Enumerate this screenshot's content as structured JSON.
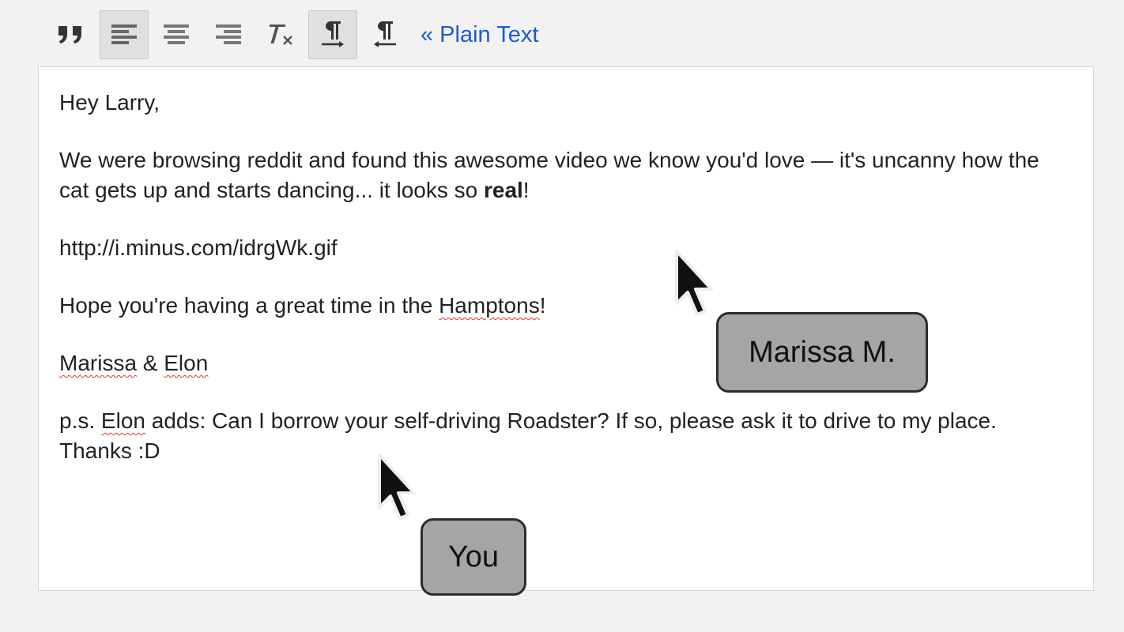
{
  "toolbar": {
    "buttons": [
      {
        "icon": "quote-icon",
        "active": false
      },
      {
        "icon": "align-left-icon",
        "active": true
      },
      {
        "icon": "align-center-icon",
        "active": false
      },
      {
        "icon": "align-right-icon",
        "active": false
      },
      {
        "icon": "remove-formatting-icon",
        "active": false
      },
      {
        "icon": "ltr-text-icon",
        "active": true
      },
      {
        "icon": "rtl-text-icon",
        "active": false
      }
    ],
    "plain_text_link": "« Plain Text"
  },
  "message": {
    "greeting": "Hey Larry,",
    "paragraph1_a": "We were browsing reddit and found this awesome video we know you'd love — it's uncanny how the cat gets up and starts dancing... it looks so ",
    "paragraph1_bold": "real",
    "paragraph1_end": "!",
    "link": "http://i.minus.com/idrgWk.gif",
    "paragraph2_a": "Hope you're having a great time in the ",
    "paragraph2_misspelled": "Hamptons",
    "paragraph2_end": "!",
    "signature_a": "Marissa",
    "signature_amp": " & ",
    "signature_b": "Elon",
    "ps_a": "p.s. ",
    "ps_misspelled": "Elon",
    "ps_rest": " adds: Can I borrow your self-driving Roadster?  If so, please ask it to drive to my place.  Thanks :D"
  },
  "collaborators": [
    {
      "label": "Marissa M."
    },
    {
      "label": "You"
    }
  ],
  "colors": {
    "link": "#1a5bd6",
    "spellcheck": "#e23333",
    "tag_fill": "#a5a5a5"
  }
}
